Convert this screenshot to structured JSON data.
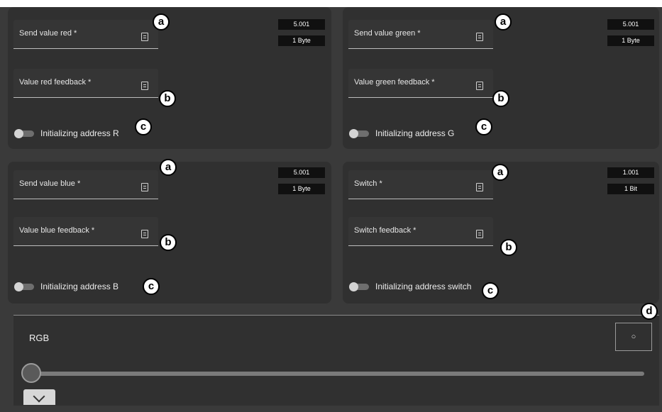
{
  "cards": {
    "red": {
      "send_label": "Send value red *",
      "feedback_label": "Value red feedback *",
      "type_code": "5.001",
      "type_size": "1 Byte",
      "toggle_label": "Initializing address R"
    },
    "green": {
      "send_label": "Send value green *",
      "feedback_label": "Value green feedback *",
      "type_code": "5.001",
      "type_size": "1 Byte",
      "toggle_label": "Initializing address G"
    },
    "blue": {
      "send_label": "Send value blue *",
      "feedback_label": "Value blue feedback *",
      "type_code": "5.001",
      "type_size": "1 Byte",
      "toggle_label": "Initializing address B"
    },
    "switch": {
      "send_label": "Switch *",
      "feedback_label": "Switch feedback *",
      "type_code": "1.001",
      "type_size": "1 Bit",
      "toggle_label": "Initializing address switch"
    }
  },
  "markers": {
    "a": "a",
    "b": "b",
    "c": "c",
    "d": "d"
  },
  "rgb": {
    "title": "RGB",
    "button_icon": "circle-icon",
    "button_glyph": "○",
    "slider_value": 0
  },
  "icons": {
    "field": "document-icon",
    "expand": "chevron-down-icon"
  },
  "colors": {
    "background": "#3a3a3a",
    "card": "#303030",
    "tag": "#101010",
    "marker_bg": "#ffffff",
    "marker_border": "#000000"
  }
}
